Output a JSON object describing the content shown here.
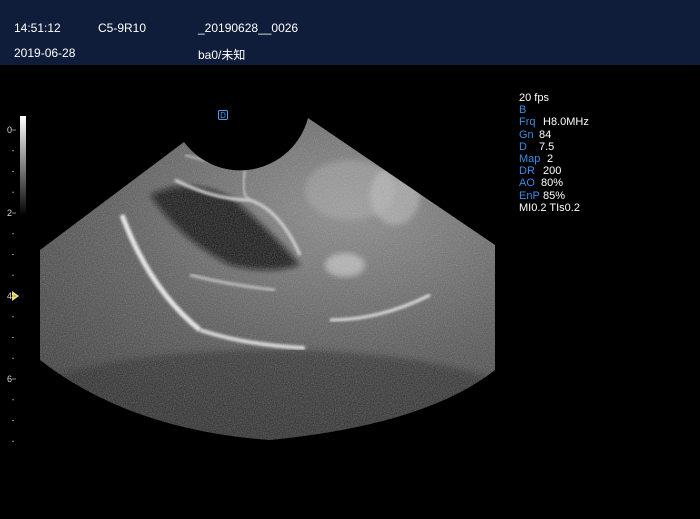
{
  "header": {
    "time": "14:51:12",
    "date": "2019-06-28",
    "probe": "C5-9R10",
    "exam_id": "_20190628__0026",
    "patient": "ba0/未知"
  },
  "depth_scale": {
    "labels": [
      "0",
      "2",
      "4",
      "6"
    ],
    "focus_marker_color": "#f2e36a"
  },
  "orientation_marker": {
    "label": "D",
    "color": "#4a9cf0"
  },
  "params": {
    "frame_rate": "20 fps",
    "mode": "B",
    "rows": [
      {
        "key": "Frq",
        "value": "H8.0MHz"
      },
      {
        "key": "Gn",
        "value": "84"
      },
      {
        "key": "D",
        "value": "7.5"
      },
      {
        "key": "Map",
        "value": "2"
      },
      {
        "key": "DR",
        "value": "200"
      },
      {
        "key": "AO",
        "value": "80%"
      },
      {
        "key": "EnP",
        "value": "85%"
      }
    ],
    "safety": "MI0.2 TIs0.2"
  },
  "colors": {
    "header_bg": "#0f1d3a",
    "param_key": "#3a8be6",
    "background": "#000000"
  }
}
